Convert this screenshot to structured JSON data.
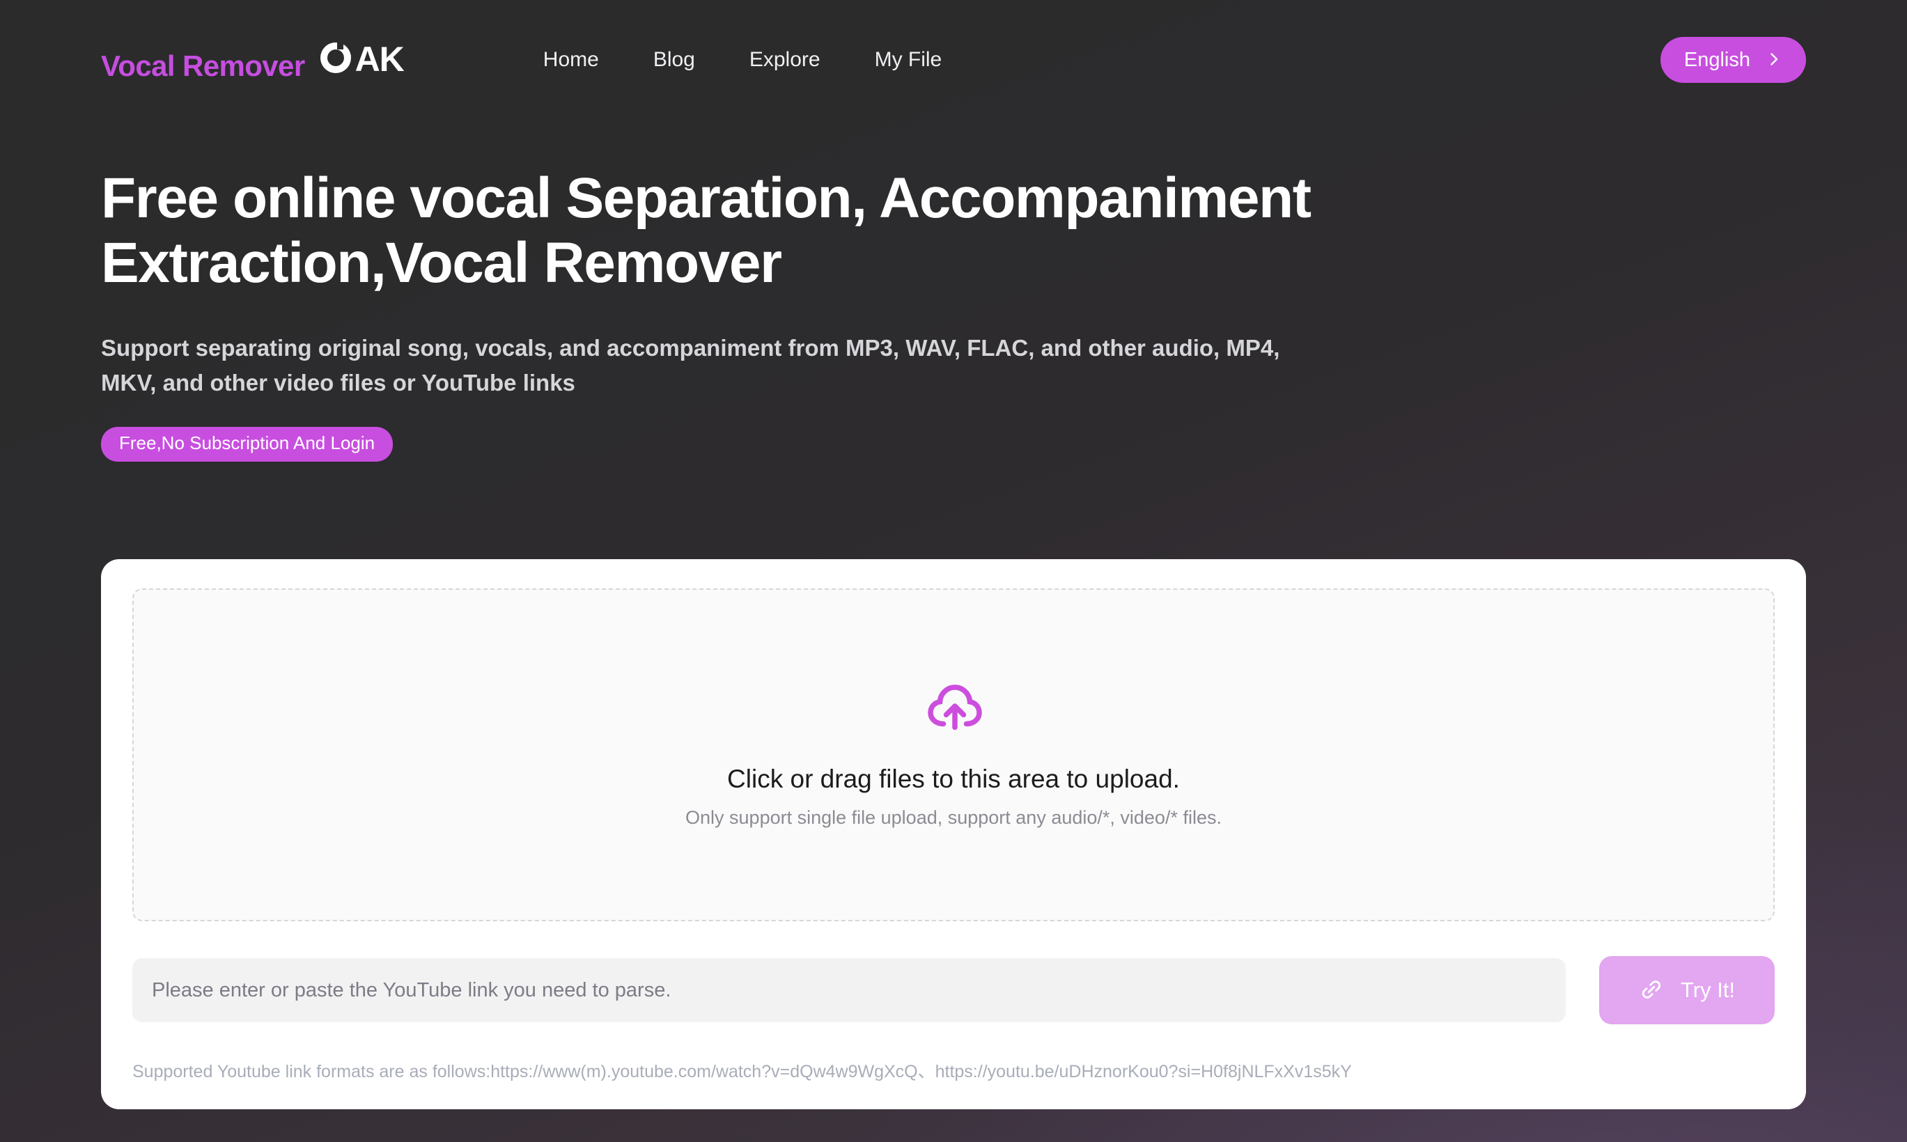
{
  "brand": {
    "word": "Vocal Remover",
    "mark_o": "o-ring-notched-icon",
    "mark_ak": "AK",
    "word_color": "#c64ee0",
    "mark_color": "#ffffff"
  },
  "nav": {
    "items": [
      {
        "label": "Home"
      },
      {
        "label": "Blog"
      },
      {
        "label": "Explore"
      },
      {
        "label": "My File"
      }
    ]
  },
  "language_button": {
    "label": "English",
    "icon": "chevron-right-icon",
    "bg_color": "#c84ee0",
    "text_color": "#ffffff"
  },
  "hero": {
    "headline": "Free online vocal Separation, Accompaniment Extraction,Vocal Remover",
    "subhead": "Support separating original song, vocals, and accompaniment from MP3, WAV, FLAC, and other audio, MP4, MKV, and other video files or YouTube links",
    "badge": "Free,No Subscription And Login",
    "badge_color": "#c84ee0"
  },
  "upload": {
    "icon": "cloud-upload-icon",
    "icon_color": "#cc4edd",
    "title": "Click or drag files to this area to upload.",
    "subtitle": "Only support single file upload, support any audio/*, video/* files."
  },
  "link_form": {
    "input_value": "",
    "input_placeholder": "Please enter or paste the YouTube link you need to parse.",
    "button_label": "Try It!",
    "button_icon": "link-chain-icon",
    "button_color": "#e3a6f0",
    "hint": "Supported Youtube link formats are as follows:https://www(m).youtube.com/watch?v=dQw4w9WgXcQ、https://youtu.be/uDHznorKou0?si=H0f8jNLFxXv1s5kY"
  },
  "theme": {
    "page_bg": "#2b2b2b",
    "card_bg": "#ffffff",
    "accent": "#c84ee0"
  }
}
